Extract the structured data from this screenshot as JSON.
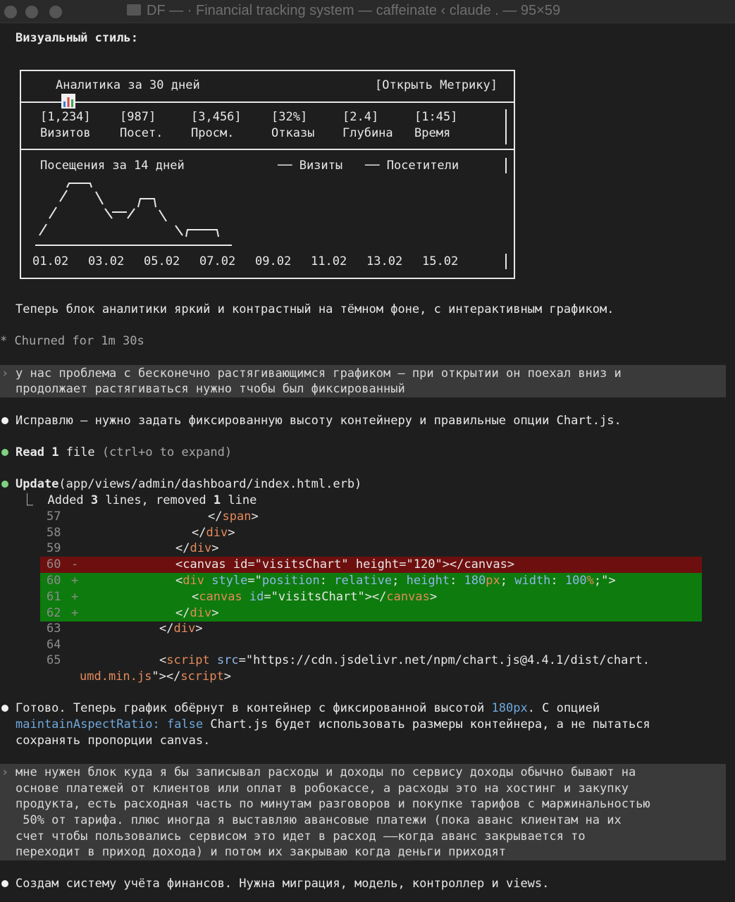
{
  "window": {
    "title": "DF — · Financial tracking system — caffeinate ‹ claude . — 95×59"
  },
  "visual_style_heading": "Визуальный стиль:",
  "analytics_box": {
    "icon": "bar-chart-icon",
    "title": "Аналитика за 30 дней",
    "open_link": "[Открыть Метрику]",
    "metrics": [
      {
        "value": "[1,234]",
        "label": "Визитов"
      },
      {
        "value": "[987]",
        "label": "Посет."
      },
      {
        "value": "[3,456]",
        "label": "Просм."
      },
      {
        "value": "[32%]",
        "label": "Отказы"
      },
      {
        "value": "[2.4]",
        "label": "Глубина"
      },
      {
        "value": "[1:45]",
        "label": "Время"
      }
    ],
    "chart_title": "Посещения за 14 дней",
    "legend": [
      "── Визиты",
      "── Посетители"
    ],
    "dates": [
      "01.02",
      "03.02",
      "05.02",
      "07.02",
      "09.02",
      "11.02",
      "13.02",
      "15.02"
    ]
  },
  "msg_bright": "Теперь блок аналитики яркий и контрастный на тёмном фоне, с интерактивным графиком.",
  "churned": "* Churned for 1m 30s",
  "user1": {
    "caret": "›",
    "lines": [
      "у нас проблема с бесконечно растягивающимся графиком — при открытии он поехал вниз и",
      "продолжает растягиваться нужно тчобы был фиксированный"
    ]
  },
  "msg_fix": "Исправлю — нужно задать фиксированную высоту контейнеру и правильные опции Chart.js.",
  "read_tool": {
    "name": "Read",
    "count": "1",
    "rest": "file",
    "hint": "(ctrl+o to expand)"
  },
  "update_tool": {
    "name": "Update",
    "path": "(app/views/admin/dashboard/index.html.erb)",
    "summary_prefix": "⎿  Added ",
    "added": "3",
    "mid": " lines, removed ",
    "removed": "1",
    "suffix": " line"
  },
  "diff": {
    "lines": [
      {
        "n": "57",
        "sign": "",
        "type": "ctx"
      },
      {
        "n": "58",
        "sign": "",
        "type": "ctx"
      },
      {
        "n": "59",
        "sign": "",
        "type": "ctx"
      },
      {
        "n": "60",
        "sign": "-",
        "type": "del"
      },
      {
        "n": "60",
        "sign": "+",
        "type": "add"
      },
      {
        "n": "61",
        "sign": "+",
        "type": "add"
      },
      {
        "n": "62",
        "sign": "+",
        "type": "add"
      },
      {
        "n": "63",
        "sign": "",
        "type": "ctx"
      },
      {
        "n": "64",
        "sign": "",
        "type": "ctx"
      },
      {
        "n": "65",
        "sign": "",
        "type": "ctx"
      }
    ],
    "code": {
      "l57_open": "</",
      "l57_tag": "span",
      "l57_close": ">",
      "l58_open": "</",
      "l58_tag": "div",
      "l58_close": ">",
      "l59_open": "</",
      "l59_tag": "div",
      "l59_close": ">",
      "l60del": "<canvas id=\"visitsChart\" height=\"120\"></canvas>",
      "l60_lt": "<",
      "l60_tag": "div",
      "l60_sp": " ",
      "l60_attr": "style",
      "l60_eq": "=\"",
      "l60_p1": "position",
      "l60_c1": ": ",
      "l60_v1": "relative",
      "l60_s1": "; ",
      "l60_p2": "height",
      "l60_c2": ": ",
      "l60_v2n": "180",
      "l60_v2u": "px",
      "l60_s2": "; ",
      "l60_p3": "width",
      "l60_c3": ": ",
      "l60_v3n": "100",
      "l60_v3u": "%",
      "l60_end": ";\">",
      "l61_lt": "<",
      "l61_tag": "canvas",
      "l61_sp": " ",
      "l61_attr": "id",
      "l61_val": "=\"visitsChart\"></",
      "l61_tag2": "canvas",
      "l61_gt": ">",
      "l62_open": "</",
      "l62_tag": "div",
      "l62_close": ">",
      "l63_open": "</",
      "l63_tag": "div",
      "l63_close": ">",
      "l65_lt": "<",
      "l65_tag": "script",
      "l65_sp": " ",
      "l65_attr": "src",
      "l65_val": "=\"https://cdn.jsdelivr.net/npm/chart.js@4.4.1/dist/chart.",
      "l65b_val": "umd.min.js",
      "l65b_end": "\"></",
      "l65b_tag": "script",
      "l65b_gt": ">"
    }
  },
  "msg_done": {
    "l1a": "Готово. Теперь график обёрнут в контейнер с фиксированной высотой ",
    "l1b": "180px",
    "l1c": ". С опцией",
    "l2a": "maintainAspectRatio: false",
    "l2b": " Chart.js будет использовать размеры контейнера, а не пытаться",
    "l3": "сохранять пропорции canvas."
  },
  "user2": {
    "caret": "›",
    "lines": [
      "мне нужен блок куда я бы записывал расходы и доходы по сервису доходы обычно бывают на",
      "основе платежей от клиентов или оплат в робокассе, а расходы это на хостинг и закупку",
      "продукта, есть расходная часть по минутам разговоров и покупке тарифов с маржинальностью",
      " 50% от тарифа. плюс иногда я выставляю авансовые платежи (пока аванс клиентам на их",
      "счет чтобы пользовались сервисом это идет в расход ——когда аванс закрывается то",
      "переходит в приход дохода) и потом их закрываю когда деньги приходят"
    ]
  },
  "msg_create": "Создам систему учёта финансов. Нужна миграция, модель, контроллер и views."
}
